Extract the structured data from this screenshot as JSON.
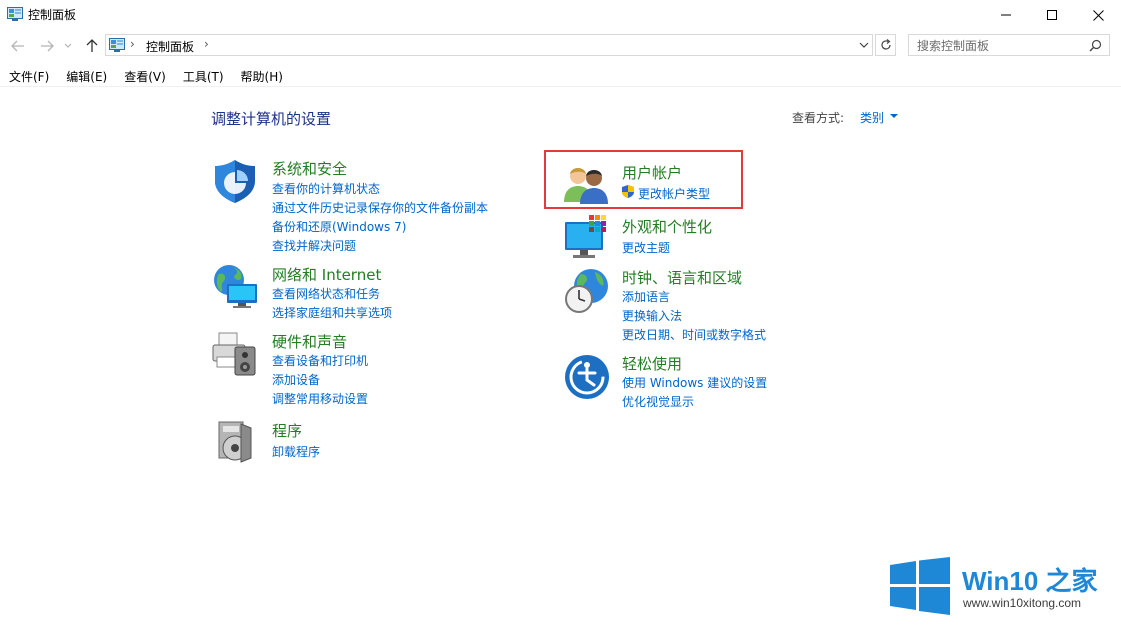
{
  "window": {
    "title": "控制面板",
    "minimize_glyph": "minimize-icon",
    "maximize_glyph": "maximize-icon",
    "close_glyph": "close-icon"
  },
  "address": {
    "breadcrumb": "控制面板",
    "separator": "›",
    "search_placeholder": "搜索控制面板"
  },
  "menu": [
    "文件(F)",
    "编辑(E)",
    "查看(V)",
    "工具(T)",
    "帮助(H)"
  ],
  "content": {
    "heading": "调整计算机的设置",
    "view_by_label": "查看方式:",
    "view_by_value": "类别"
  },
  "categories": {
    "system_security": {
      "title": "系统和安全",
      "icon": "shield-icon",
      "links": [
        "查看你的计算机状态",
        "通过文件历史记录保存你的文件备份副本",
        "备份和还原(Windows 7)",
        "查找并解决问题"
      ]
    },
    "network": {
      "title": "网络和 Internet",
      "icon": "network-globe-icon",
      "links": [
        "查看网络状态和任务",
        "选择家庭组和共享选项"
      ]
    },
    "hardware": {
      "title": "硬件和声音",
      "icon": "printer-speaker-icon",
      "links": [
        "查看设备和打印机",
        "添加设备",
        "调整常用移动设置"
      ]
    },
    "programs": {
      "title": "程序",
      "icon": "programs-disc-icon",
      "links": [
        "卸载程序"
      ]
    },
    "user_accounts": {
      "title": "用户帐户",
      "icon": "users-icon",
      "links": [
        "更改帐户类型"
      ]
    },
    "appearance": {
      "title": "外观和个性化",
      "icon": "monitor-palette-icon",
      "links": [
        "更改主题"
      ]
    },
    "clock_region": {
      "title": "时钟、语言和区域",
      "icon": "clock-globe-icon",
      "links": [
        "添加语言",
        "更换输入法",
        "更改日期、时间或数字格式"
      ]
    },
    "ease_of_access": {
      "title": "轻松使用",
      "icon": "ease-of-access-icon",
      "links": [
        "使用 Windows 建议的设置",
        "优化视觉显示"
      ]
    }
  },
  "watermark": {
    "brand": "Win10 之家",
    "url": "www.win10xitong.com"
  },
  "colors": {
    "category_title": "#247d24",
    "link": "#0066cc",
    "heading": "#1e3287",
    "highlight": "#e33b3b"
  }
}
